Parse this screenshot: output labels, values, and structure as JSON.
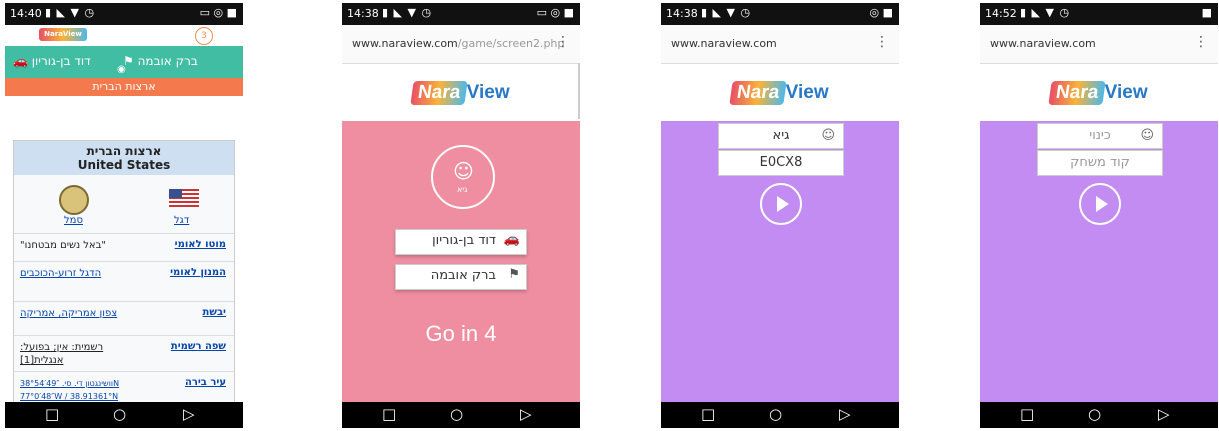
{
  "phone1": {
    "status_time": "14:40",
    "logo_text": "NaraView",
    "badge": "3",
    "teal_left": "דוד בן-גוריון",
    "teal_right": "ברק אובמה",
    "orange_label": "ארצות הברית",
    "infobox": {
      "title_he": "ארצות הברית",
      "title_en": "United States",
      "seal_caption": "סמל",
      "flag_caption": "דגל",
      "rows": [
        {
          "label": "מוטו לאומי",
          "value": "\"באל נשים מבטחנו\""
        },
        {
          "label": "המנון לאומי",
          "value": "הדגל זרוע-הכוכבים"
        },
        {
          "label": "יבשת",
          "value": "צפון אמריקה, אמריקה"
        },
        {
          "label": "שפה רשמית",
          "value": "רשמית: אין; בפועל: אנגלית[1]"
        },
        {
          "label": "עיר בירה",
          "value": "וושינגטון די. סי. 38°54′49″N 77°0′48″W / 38.91361°N"
        }
      ]
    }
  },
  "phone2": {
    "status_time": "14:38",
    "url_domain": "www.naraview.com",
    "url_path": "/game/screen2.php",
    "avatar_name": "גיא",
    "button1": "דוד בן-גוריון",
    "button2": "ברק אובמה",
    "go_label": "Go in 4"
  },
  "phone3": {
    "status_time": "14:38",
    "url": "www.naraview.com",
    "name_value": "גיא",
    "code_value": "E0CX8"
  },
  "phone4": {
    "status_time": "14:52",
    "url": "www.naraview.com",
    "name_placeholder": "כינוי",
    "code_placeholder": "קוד משחק"
  },
  "logo": {
    "nara": "Nara",
    "view": "View"
  }
}
